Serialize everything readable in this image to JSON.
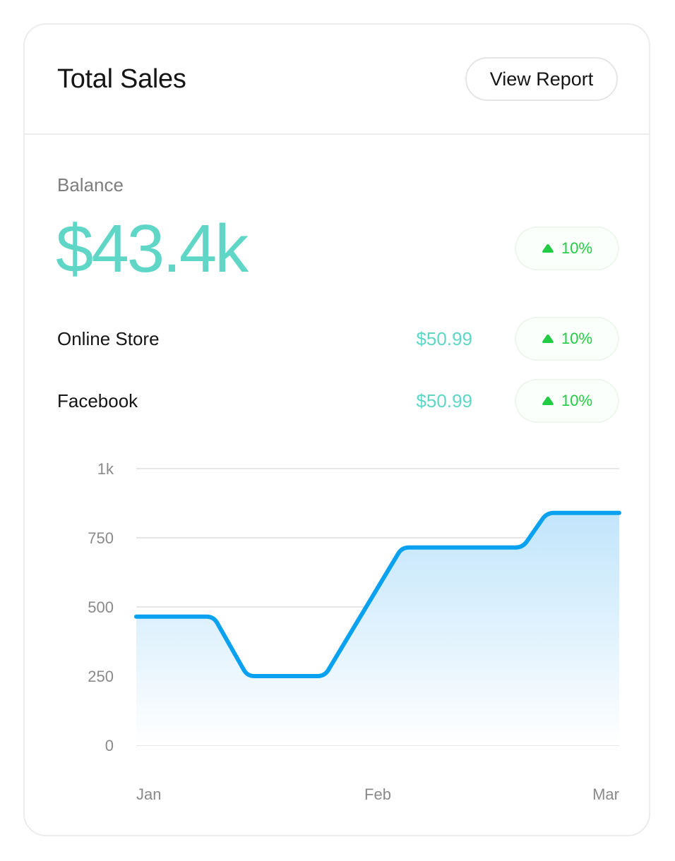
{
  "header": {
    "title": "Total Sales",
    "view_report_label": "View Report"
  },
  "balance": {
    "label": "Balance",
    "value": "$43.4k",
    "change": "10%"
  },
  "rows": [
    {
      "label": "Online Store",
      "value": "$50.99",
      "change": "10%"
    },
    {
      "label": "Facebook",
      "value": "$50.99",
      "change": "10%"
    }
  ],
  "colors": {
    "accent_teal": "#5fd6c6",
    "positive_green": "#22cc44",
    "line_blue": "#0aa2f0"
  },
  "chart_data": {
    "type": "area",
    "x": [
      0,
      0.16,
      0.23,
      0.39,
      0.55,
      0.8,
      0.85,
      1.0
    ],
    "y": [
      465,
      465,
      250,
      250,
      715,
      715,
      840,
      840
    ],
    "x_tick_labels": [
      "Jan",
      "Feb",
      "Mar"
    ],
    "y_ticks": [
      0,
      250,
      500,
      750,
      1000
    ],
    "y_tick_labels": [
      "0",
      "250",
      "500",
      "750",
      "1k"
    ],
    "ylim": [
      0,
      1000
    ],
    "grid": true,
    "legend": "none"
  }
}
